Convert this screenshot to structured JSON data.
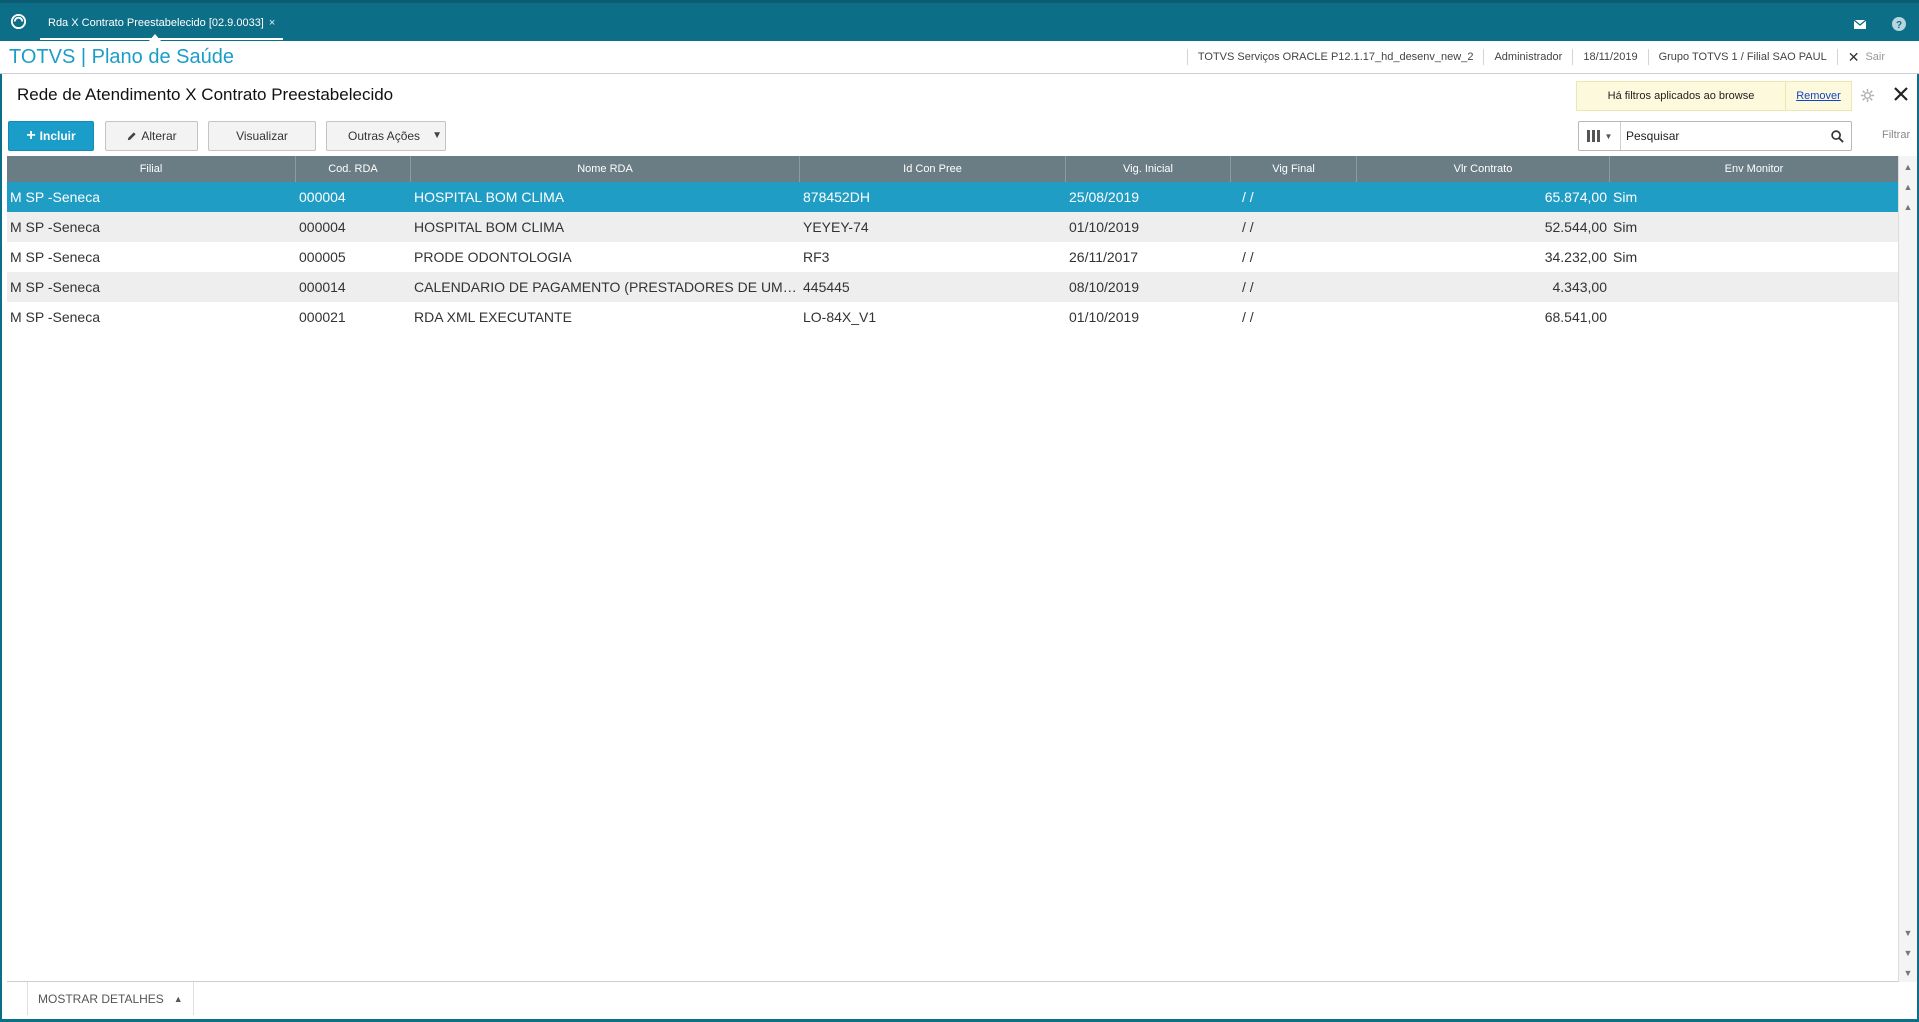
{
  "tab": {
    "label": "Rda X Contrato Preestabelecido [02.9.0033]",
    "close": "×"
  },
  "header": {
    "app_title": "TOTVS | Plano de Saúde",
    "environment": "TOTVS Serviços ORACLE P12.1.17_hd_desenv_new_2",
    "user": "Administrador",
    "date": "18/11/2019",
    "company": "Grupo TOTVS 1 / Filial SAO PAUL",
    "exit_label": "Sair"
  },
  "page": {
    "title": "Rede de Atendimento X Contrato Preestabelecido",
    "filter_notice": "Há filtros aplicados ao browse",
    "remove_label": "Remover"
  },
  "toolbar": {
    "include_label": "Incluir",
    "edit_label": "Alterar",
    "view_label": "Visualizar",
    "other_actions_label": "Outras Ações",
    "search_placeholder": "Pesquisar",
    "filter_label": "Filtrar"
  },
  "grid": {
    "columns": [
      "Filial",
      "Cod. RDA",
      "Nome RDA",
      "Id Con Pree",
      "Vig. Inicial",
      "Vig Final",
      "Vlr Contrato",
      "Env Monitor"
    ],
    "rows": [
      {
        "filial": "M SP    -Seneca",
        "cod_rda": "000004",
        "nome_rda": "HOSPITAL BOM CLIMA",
        "id_con_pree": "878452DH",
        "vig_inicial": "25/08/2019",
        "vig_final": "/  /",
        "vlr_contrato": "65.874,00",
        "env_monitor": "Sim"
      },
      {
        "filial": "M SP    -Seneca",
        "cod_rda": "000004",
        "nome_rda": "HOSPITAL BOM CLIMA",
        "id_con_pree": "YEYEY-74",
        "vig_inicial": "01/10/2019",
        "vig_final": "/  /",
        "vlr_contrato": "52.544,00",
        "env_monitor": "Sim"
      },
      {
        "filial": "M SP    -Seneca",
        "cod_rda": "000005",
        "nome_rda": "PRODE ODONTOLOGIA",
        "id_con_pree": "RF3",
        "vig_inicial": "26/11/2017",
        "vig_final": "/  /",
        "vlr_contrato": "34.232,00",
        "env_monitor": "Sim"
      },
      {
        "filial": "M SP    -Seneca",
        "cod_rda": "000014",
        "nome_rda": "CALENDARIO DE PAGAMENTO (PRESTADORES DE UMA...",
        "id_con_pree": "445445",
        "vig_inicial": "08/10/2019",
        "vig_final": "/  /",
        "vlr_contrato": "4.343,00",
        "env_monitor": ""
      },
      {
        "filial": "M SP    -Seneca",
        "cod_rda": "000021",
        "nome_rda": "RDA XML EXECUTANTE",
        "id_con_pree": "LO-84X_V1",
        "vig_inicial": "01/10/2019",
        "vig_final": "/  /",
        "vlr_contrato": "68.541,00",
        "env_monitor": ""
      }
    ]
  },
  "footer": {
    "details_label": "MOSTRAR DETALHES"
  },
  "colors": {
    "brand": "#0d6e87",
    "accent": "#1a9ec9",
    "selected_row": "#1f9dc5",
    "grid_header": "#6a7d85"
  }
}
